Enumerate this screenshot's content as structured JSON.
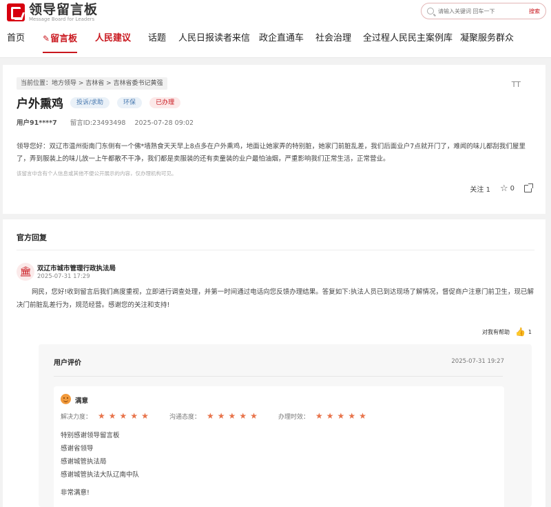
{
  "logo": {
    "cn": "领导留言板",
    "en": "Message Board for Leaders"
  },
  "search": {
    "placeholder": "请输入关键词 回车一下",
    "button": "搜索"
  },
  "nav": [
    "首页",
    "留言板",
    "人民建议",
    "话题",
    "人民日报读者来信",
    "政企直通车",
    "社会治理",
    "全过程人民民主案例库",
    "凝聚服务群众"
  ],
  "message": {
    "breadcrumb": "当前位置：地方领导 > 吉林省 > 吉林省委书记黄强",
    "font_size_icon": "TT",
    "title": "户外熏鸡",
    "tags": [
      "投诉/求助",
      "环保",
      "已办理"
    ],
    "user": "用户91****7",
    "id": "留言ID:23493498",
    "time": "2025-07-28 09:02",
    "content": "领导您好：双辽市温州街南门东侧有一个佛*墙熟食天天早上8点多在户外熏鸡，地面让她家弄的特别脏，她家门前脏乱差，我们后面业户7点就开门了，难闻的味儿都刮我们屋里了，弄到服装上的味儿放一上午都散不干净，我们都是卖服装的还有卖童装的业户最怕油烟，严重影响我们正常生活，正常营业。",
    "disclaimer": "该留言中含有个人信息或其他不便公开展示的内容，仅办理机构可见。",
    "follow": "关注 1",
    "favorites": "0"
  },
  "reply": {
    "section_title": "官方回复",
    "department": "双辽市城市管理行政执法局",
    "time": "2025-07-31 17:29",
    "content": "网民，您好!收到留言后我们高度重视，立即进行调查处理，并第一时间通过电话向您反馈办理结果。答复如下:执法人员已到达现场了解情况，督促商户注意门前卫生，现已解决门前脏乱差行为，规范经营。感谢您的关注和支持!",
    "helpful_label": "对我有帮助",
    "helpful_count": "1"
  },
  "evaluation": {
    "title": "用户评价",
    "time": "2025-07-31 19:27",
    "satisfaction": "满意",
    "ratings": [
      {
        "label": "解决力度：",
        "stars": 5
      },
      {
        "label": "沟通态度：",
        "stars": 5
      },
      {
        "label": "办理时效：",
        "stars": 5
      }
    ],
    "comments": [
      "特别感谢领导留言板",
      "感谢省领导",
      "感谢城管执法局",
      "感谢城管执法大队辽南中队"
    ],
    "final": "非常满意!"
  },
  "colors": {
    "brand_red": "#c9171e",
    "star": "#e8734a",
    "tag_blue": "#4a7ab0"
  }
}
